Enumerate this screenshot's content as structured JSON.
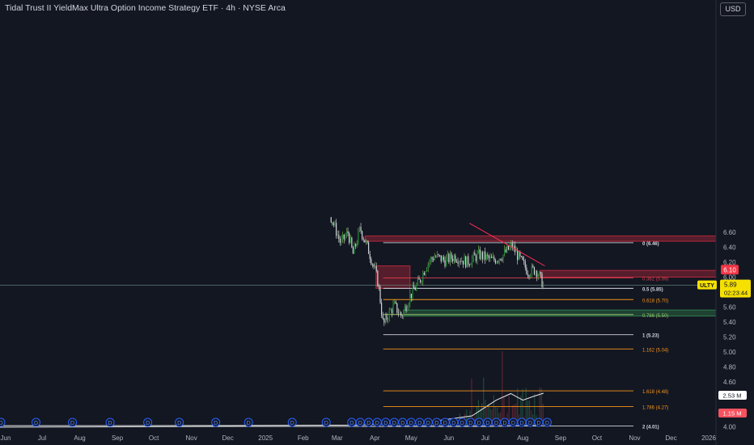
{
  "title": "Tidal Trust II YieldMax Ultra Option Income Strategy ETF · 4h · NYSE Arca",
  "currency": "USD",
  "colors": {
    "background": "#131722",
    "up": "#26a69a",
    "down": "#ef5350",
    "candle_up": "#8fd14f",
    "fib_white": "#d1d4dc",
    "fib_orange": "#f7931a",
    "fib_red": "#e04050",
    "zone_red": "#7a1f2b",
    "zone_green": "#1f5a2e",
    "trend": "#ff2d55",
    "event": "#2962ff"
  },
  "chart_data": {
    "type": "candlestick",
    "symbol": "ULTY",
    "interval": "4h",
    "last_price": "5.89",
    "countdown": "02:23:44",
    "red_price_label": "6.10",
    "volume_labels": [
      "2.53 M",
      "1.15 M"
    ],
    "ylim": [
      4.0,
      6.72
    ],
    "y_ticks": [
      6.6,
      6.4,
      6.2,
      6.0,
      5.8,
      5.6,
      5.4,
      5.2,
      5.0,
      4.8,
      4.6,
      4.4,
      4.2,
      4.0
    ],
    "y_tick_labels": [
      "6.60",
      "6.40",
      "6.20",
      "6.00",
      "5.80",
      "5.60",
      "5.40",
      "5.20",
      "5.00",
      "4.80",
      "4.60",
      "4.40",
      "4.20",
      "4.00"
    ],
    "x_ticks": [
      {
        "label": "Jun",
        "date": "2024-06-01"
      },
      {
        "label": "Jul",
        "date": "2024-07-01"
      },
      {
        "label": "Aug",
        "date": "2024-08-01"
      },
      {
        "label": "Sep",
        "date": "2024-09-01"
      },
      {
        "label": "Oct",
        "date": "2024-10-01"
      },
      {
        "label": "Nov",
        "date": "2024-11-01"
      },
      {
        "label": "Dec",
        "date": "2024-12-01"
      },
      {
        "label": "2025",
        "date": "2025-01-01"
      },
      {
        "label": "Feb",
        "date": "2025-02-01"
      },
      {
        "label": "Mar",
        "date": "2025-03-01"
      },
      {
        "label": "Apr",
        "date": "2025-04-01"
      },
      {
        "label": "May",
        "date": "2025-05-01"
      },
      {
        "label": "Jun",
        "date": "2025-06-01"
      },
      {
        "label": "Jul",
        "date": "2025-07-01"
      },
      {
        "label": "Aug",
        "date": "2025-08-01"
      },
      {
        "label": "Sep",
        "date": "2025-09-01"
      },
      {
        "label": "Oct",
        "date": "2025-10-01"
      },
      {
        "label": "Nov",
        "date": "2025-11-01"
      },
      {
        "label": "Dec",
        "date": "2025-12-01"
      },
      {
        "label": "2026",
        "date": "2026-01-01"
      }
    ],
    "fib_levels": [
      {
        "level": 0,
        "price": 6.46,
        "label": "0 (6.46)",
        "color": "#d1d4dc"
      },
      {
        "level": 0.382,
        "price": 5.99,
        "label": "0.382 (5.99)",
        "color": "#e04050"
      },
      {
        "level": 0.5,
        "price": 5.85,
        "label": "0.5 (5.85)",
        "color": "#d1d4dc"
      },
      {
        "level": 0.618,
        "price": 5.7,
        "label": "0.618 (5.70)",
        "color": "#f7931a"
      },
      {
        "level": 0.786,
        "price": 5.5,
        "label": "0.786 (5.50)",
        "color": "#9bc46a"
      },
      {
        "level": 1,
        "price": 5.23,
        "label": "1 (5.23)",
        "color": "#d1d4dc"
      },
      {
        "level": 1.162,
        "price": 5.04,
        "label": "1.162 (5.04)",
        "color": "#f7931a"
      },
      {
        "level": 1.618,
        "price": 4.48,
        "label": "1.618 (4.48)",
        "color": "#f7931a"
      },
      {
        "level": 1.786,
        "price": 4.27,
        "label": "1.786 (4.27)",
        "color": "#f7931a"
      },
      {
        "level": 2,
        "price": 4.01,
        "label": "2 (4.01)",
        "color": "#d1d4dc"
      }
    ],
    "fib_x_range": [
      "2025-04-08",
      "2025-10-31"
    ],
    "zones": [
      {
        "kind": "supply",
        "y": [
          6.48,
          6.55
        ],
        "x": [
          "2025-03-24",
          "2026-01-20"
        ]
      },
      {
        "kind": "supply",
        "y": [
          6.15,
          5.85
        ],
        "x": [
          "2025-04-02",
          "2025-04-30"
        ]
      },
      {
        "kind": "supply",
        "y": [
          6.0,
          6.09
        ],
        "x": [
          "2025-08-15",
          "2026-01-20"
        ]
      },
      {
        "kind": "demand",
        "y": [
          5.48,
          5.56
        ],
        "x": [
          "2025-04-25",
          "2026-01-20"
        ]
      }
    ],
    "trendline": {
      "from": {
        "date": "2025-06-18",
        "price": 6.72
      },
      "to": {
        "date": "2025-08-19",
        "price": 6.15
      }
    },
    "horizontal_line": {
      "price": 5.89
    },
    "price_path": [
      {
        "date": "2025-02-24",
        "price": 6.8
      },
      {
        "date": "2025-03-04",
        "price": 6.45
      },
      {
        "date": "2025-03-10",
        "price": 6.6
      },
      {
        "date": "2025-03-14",
        "price": 6.3
      },
      {
        "date": "2025-03-20",
        "price": 6.65
      },
      {
        "date": "2025-03-27",
        "price": 6.35
      },
      {
        "date": "2025-04-01",
        "price": 6.1
      },
      {
        "date": "2025-04-04",
        "price": 5.9
      },
      {
        "date": "2025-04-08",
        "price": 5.35
      },
      {
        "date": "2025-04-12",
        "price": 5.5
      },
      {
        "date": "2025-04-17",
        "price": 5.62
      },
      {
        "date": "2025-04-23",
        "price": 5.48
      },
      {
        "date": "2025-04-30",
        "price": 5.75
      },
      {
        "date": "2025-05-08",
        "price": 5.95
      },
      {
        "date": "2025-05-14",
        "price": 6.18
      },
      {
        "date": "2025-05-20",
        "price": 6.28
      },
      {
        "date": "2025-05-29",
        "price": 6.22
      },
      {
        "date": "2025-06-06",
        "price": 6.28
      },
      {
        "date": "2025-06-16",
        "price": 6.2
      },
      {
        "date": "2025-06-26",
        "price": 6.3
      },
      {
        "date": "2025-07-07",
        "price": 6.22
      },
      {
        "date": "2025-07-16",
        "price": 6.3
      },
      {
        "date": "2025-07-23",
        "price": 6.42
      },
      {
        "date": "2025-07-29",
        "price": 6.25
      },
      {
        "date": "2025-08-05",
        "price": 6.08
      },
      {
        "date": "2025-08-12",
        "price": 6.1
      },
      {
        "date": "2025-08-18",
        "price": 5.89
      }
    ],
    "dividend_markers": {
      "label": "D",
      "dates": [
        "2024-05-28",
        "2024-06-26",
        "2024-07-26",
        "2024-08-26",
        "2024-09-26",
        "2024-10-22",
        "2024-11-21",
        "2024-12-18",
        "2025-01-23",
        "2025-02-20",
        "2025-03-13",
        "2025-03-20",
        "2025-03-27",
        "2025-04-03",
        "2025-04-10",
        "2025-04-17",
        "2025-04-24",
        "2025-05-01",
        "2025-05-08",
        "2025-05-15",
        "2025-05-22",
        "2025-05-29",
        "2025-06-05",
        "2025-06-12",
        "2025-06-19",
        "2025-06-26",
        "2025-07-03",
        "2025-07-10",
        "2025-07-17",
        "2025-07-24",
        "2025-07-31",
        "2025-08-07",
        "2025-08-14",
        "2025-08-21"
      ]
    },
    "volume_ma": [
      {
        "date": "2024-05-20",
        "value": 0.05
      },
      {
        "date": "2024-12-01",
        "value": 0.06
      },
      {
        "date": "2025-03-20",
        "value": 0.1
      },
      {
        "date": "2025-05-20",
        "value": 0.4
      },
      {
        "date": "2025-06-20",
        "value": 0.8
      },
      {
        "date": "2025-07-10",
        "value": 2.0
      },
      {
        "date": "2025-07-22",
        "value": 2.5
      },
      {
        "date": "2025-08-01",
        "value": 2.0
      },
      {
        "date": "2025-08-10",
        "value": 2.3
      },
      {
        "date": "2025-08-18",
        "value": 2.53
      }
    ]
  }
}
